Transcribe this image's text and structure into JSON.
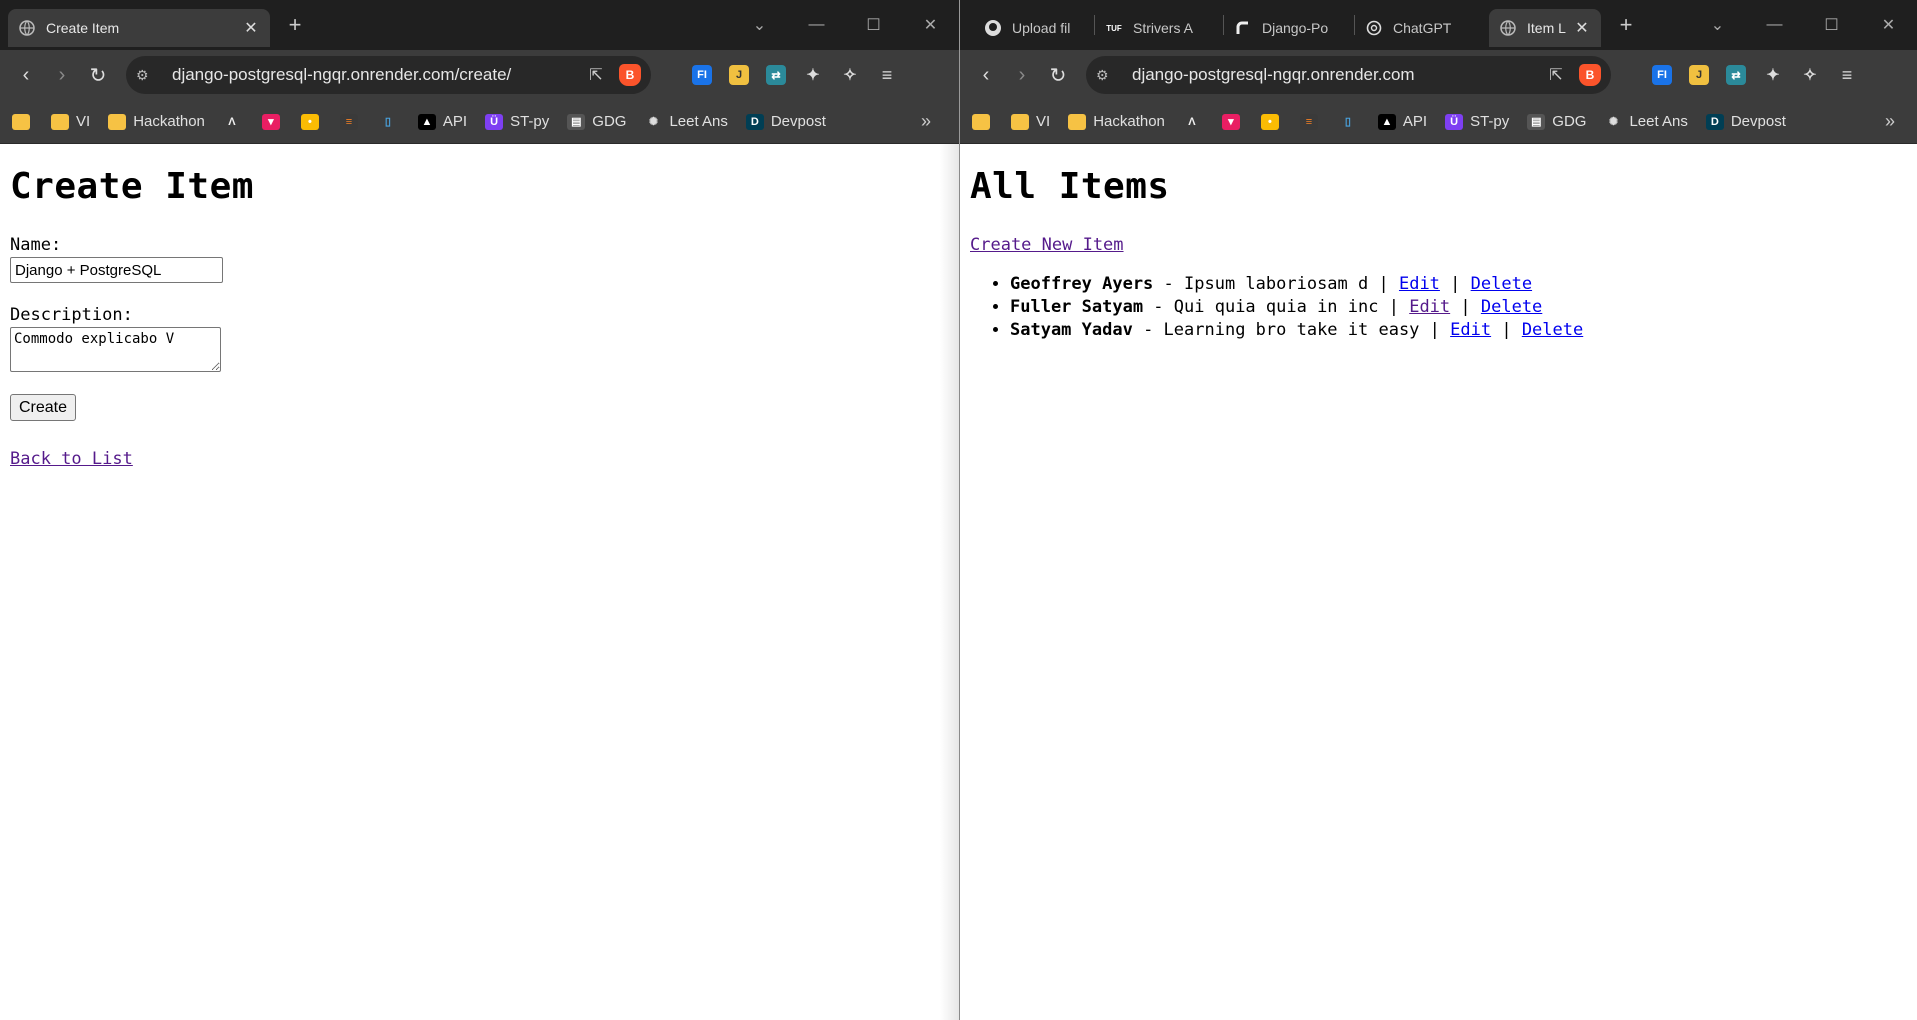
{
  "left": {
    "tab": {
      "title": "Create Item",
      "close": "✕"
    },
    "url": "django-postgresql-ngqr.onrender.com/create/",
    "page": {
      "title": "Create Item",
      "name_label": "Name:",
      "name_value": "Django + PostgreSQL",
      "description_label": "Description:",
      "description_value": "Commodo explicabo V",
      "submit_label": "Create",
      "back_link": "Back to List"
    }
  },
  "right": {
    "tabs": [
      {
        "title": "Upload fil",
        "icon": "github-icon"
      },
      {
        "title": "Strivers A",
        "icon": "tuf-icon"
      },
      {
        "title": "Django-Po",
        "icon": "render-icon"
      },
      {
        "title": "ChatGPT",
        "icon": "chatgpt-icon"
      },
      {
        "title": "Item L",
        "icon": "globe-icon",
        "close": "✕"
      }
    ],
    "url": "django-postgresql-ngqr.onrender.com",
    "page": {
      "title": "All Items",
      "create_link": "Create New Item",
      "items": [
        {
          "name": "Geoffrey Ayers",
          "description": "Ipsum laboriosam d",
          "edit": "Edit",
          "delete": "Delete"
        },
        {
          "name": "Fuller Satyam",
          "description": "Qui quia quia in inc",
          "edit": "Edit",
          "delete": "Delete"
        },
        {
          "name": "Satyam Yadav",
          "description": "Learning bro take it easy",
          "edit": "Edit",
          "delete": "Delete"
        }
      ]
    }
  },
  "bookmarks": [
    {
      "label": "",
      "icon": "folder-icon"
    },
    {
      "label": "VI",
      "icon": "folder-icon"
    },
    {
      "label": "Hackathon",
      "icon": "folder-icon"
    },
    {
      "label": "",
      "icon": "caret-logo-icon"
    },
    {
      "label": "",
      "icon": "pink-logo-icon"
    },
    {
      "label": "",
      "icon": "keep-icon"
    },
    {
      "label": "",
      "icon": "stack-icon"
    },
    {
      "label": "",
      "icon": "glass-icon"
    },
    {
      "label": "API",
      "icon": "triangle-icon"
    },
    {
      "label": "ST-py",
      "icon": "u-icon"
    },
    {
      "label": "GDG",
      "icon": "gdg-icon"
    },
    {
      "label": "Leet Ans",
      "icon": "openai-icon"
    },
    {
      "label": "Devpost",
      "icon": "devpost-icon"
    }
  ],
  "separator": " - ",
  "pipe": " | ",
  "colors": {
    "tabstrip": "#1f1f1f",
    "toolbar": "#3c3c3c",
    "link": "#0000ee",
    "visited": "#551a8b"
  }
}
